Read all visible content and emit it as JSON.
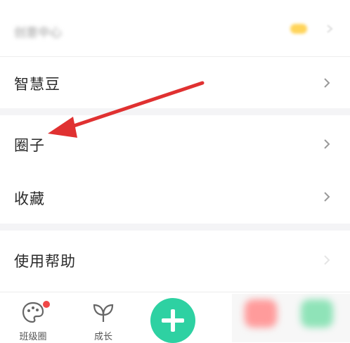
{
  "menu": {
    "top_blurred": "创意中心",
    "items": [
      {
        "label": "智慧豆"
      },
      {
        "label": "圈子"
      },
      {
        "label": "收藏"
      },
      {
        "label": "使用帮助"
      }
    ]
  },
  "tabbar": {
    "tabs": [
      {
        "label": "班级圈"
      },
      {
        "label": "成长"
      }
    ],
    "plus_icon": "plus-icon"
  },
  "colors": {
    "arrow": "#e03131",
    "accent": "#2ed1a2",
    "notification": "#f04848"
  }
}
